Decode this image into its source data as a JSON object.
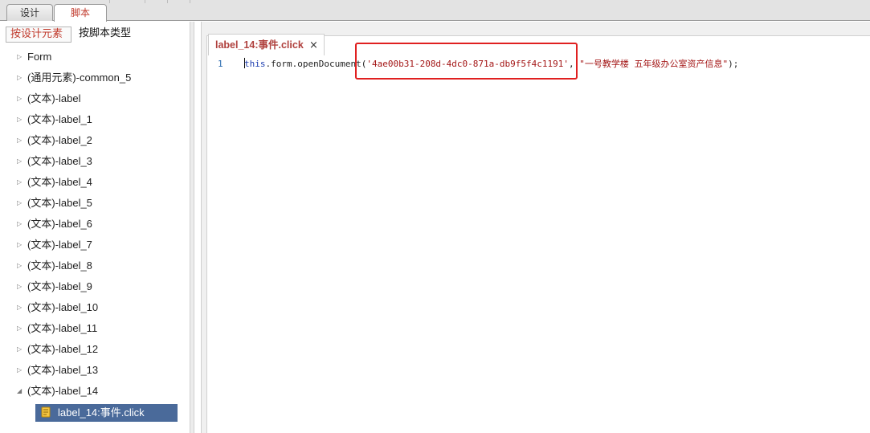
{
  "top_tabs": {
    "design": "设计",
    "script": "脚本"
  },
  "left_panel": {
    "sub_tabs": {
      "by_design_element": "按设计元素",
      "by_script_type": "按脚本类型"
    },
    "tree": [
      {
        "label": "Form",
        "expanded": false
      },
      {
        "label": "(通用元素)-common_5",
        "expanded": false
      },
      {
        "label": "(文本)-label",
        "expanded": false
      },
      {
        "label": "(文本)-label_1",
        "expanded": false
      },
      {
        "label": "(文本)-label_2",
        "expanded": false
      },
      {
        "label": "(文本)-label_3",
        "expanded": false
      },
      {
        "label": "(文本)-label_4",
        "expanded": false
      },
      {
        "label": "(文本)-label_5",
        "expanded": false
      },
      {
        "label": "(文本)-label_6",
        "expanded": false
      },
      {
        "label": "(文本)-label_7",
        "expanded": false
      },
      {
        "label": "(文本)-label_8",
        "expanded": false
      },
      {
        "label": "(文本)-label_9",
        "expanded": false
      },
      {
        "label": "(文本)-label_10",
        "expanded": false
      },
      {
        "label": "(文本)-label_11",
        "expanded": false
      },
      {
        "label": "(文本)-label_12",
        "expanded": false
      },
      {
        "label": "(文本)-label_13",
        "expanded": false
      },
      {
        "label": "(文本)-label_14",
        "expanded": true
      }
    ],
    "selected_child": {
      "label": "label_14:事件.click",
      "icon": "script-scroll-icon"
    }
  },
  "editor": {
    "file_tab": {
      "label": "label_14:事件.click",
      "close": "×"
    },
    "lines": [
      {
        "number": "1",
        "tokens": {
          "keyword": "this",
          "member": ".form.openDocument(",
          "doc_id": "'4ae00b31-208d-4dc0-871a-db9f5f4c1191'",
          "comma": ", ",
          "title_arg": "\"一号教学楼 五年级办公室资产信息\"",
          "end": ");"
        }
      }
    ]
  },
  "annotation": {
    "color": "#e02020"
  }
}
